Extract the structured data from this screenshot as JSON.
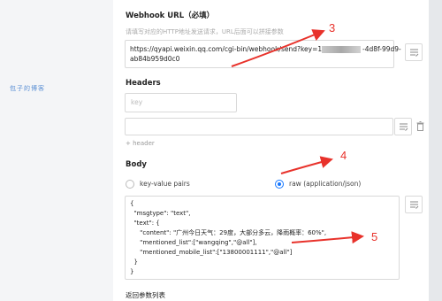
{
  "watermark": "包子的博客",
  "webhook": {
    "label": "Webhook URL（必填）",
    "hint": "请填写对应的HTTP地址发送请求，URL后面可以拼接参数",
    "url_line1": "https://qyapi.weixin.qq.com/cgi-bin/webhook/send?key=1",
    "url_key_end": "-4d8f-99d9-",
    "url_line2": "ab84b959d0c0"
  },
  "headers": {
    "label": "Headers",
    "key_placeholder": "key",
    "add_link": "+ header"
  },
  "body": {
    "label": "Body",
    "option_kv": "key-value pairs",
    "option_raw": "raw (application/json)",
    "selected": "raw (application/json)",
    "code_lines": [
      "{",
      "  \"msgtype\": \"text\",",
      "  \"text\": {",
      "     \"content\": \"广州今日天气：29度，大部分多云，降雨概率：60%\",",
      "     \"mentioned_list\":[\"wangqing\",\"@all\"],",
      "     \"mentioned_mobile_list\":[\"13800001111\",\"@all\"]",
      "  }",
      "}"
    ]
  },
  "return_params": {
    "label": "返回参数列表"
  },
  "annotations": {
    "a3": "3",
    "a4": "4",
    "a5": "5",
    "color": "#e8322b"
  },
  "colors": {
    "accent": "#1677ff",
    "border": "#d9d9d9"
  }
}
